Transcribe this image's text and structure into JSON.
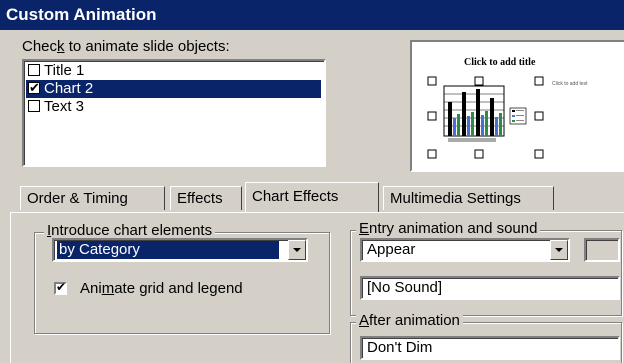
{
  "window": {
    "title": "Custom Animation"
  },
  "objects": {
    "label_pre": "Chec",
    "label_key": "k",
    "label_post": " to animate slide objects:",
    "items": [
      {
        "label": "Title 1",
        "checked": false,
        "selected": false
      },
      {
        "label": "Chart 2",
        "checked": true,
        "selected": true
      },
      {
        "label": "Text 3",
        "checked": false,
        "selected": false
      }
    ]
  },
  "preview": {
    "title_placeholder": "Click to add title",
    "text_placeholder": "Click to add text"
  },
  "tabs": [
    {
      "label": "Order & Timing",
      "active": false
    },
    {
      "label": "Effects",
      "active": false
    },
    {
      "label": "Chart Effects",
      "active": true
    },
    {
      "label": "Multimedia Settings",
      "active": false
    }
  ],
  "introduce": {
    "title_key": "I",
    "title_rest": "ntroduce chart elements",
    "value": "by Category",
    "animate_grid": {
      "checked": true,
      "pre": "Ani",
      "key": "m",
      "post": "ate grid and legend"
    }
  },
  "entry": {
    "title_key": "E",
    "title_rest": "ntry animation and sound",
    "effect": "Appear",
    "sound": "[No Sound]"
  },
  "after": {
    "title_key": "A",
    "title_rest": "fter animation",
    "value": "Don't Dim"
  },
  "colors": {
    "titlebar": "#0a246a",
    "face": "#d4d0c8",
    "selection": "#0a246a"
  }
}
